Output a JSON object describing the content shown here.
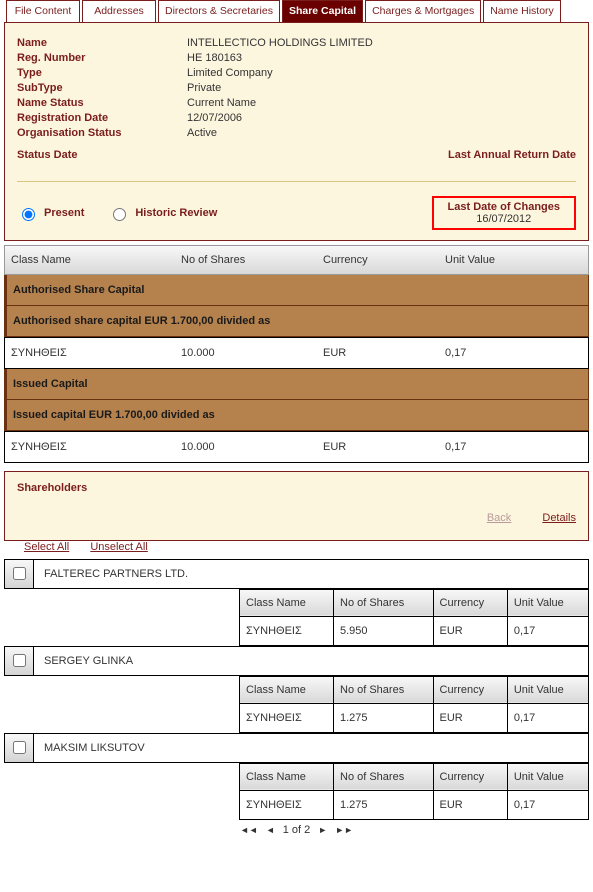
{
  "tabs": {
    "t0": "File Content",
    "t1": "Addresses",
    "t2": "Directors & Secretaries",
    "t3": "Share Capital",
    "t4": "Charges & Mortgages",
    "t5": "Name History"
  },
  "info": {
    "name_label": "Name",
    "name_value": "INTELLECTICO HOLDINGS LIMITED",
    "reg_label": "Reg. Number",
    "reg_value": "HE 180163",
    "type_label": "Type",
    "type_value": "Limited Company",
    "subtype_label": "SubType",
    "subtype_value": "Private",
    "namestatus_label": "Name Status",
    "namestatus_value": "Current Name",
    "regdate_label": "Registration Date",
    "regdate_value": "12/07/2006",
    "orgstatus_label": "Organisation Status",
    "orgstatus_value": "Active",
    "status_date_label": "Status Date",
    "last_return_label": "Last Annual Return Date"
  },
  "radio": {
    "present": "Present",
    "historic": "Historic Review"
  },
  "changes": {
    "title": "Last Date of Changes",
    "date": "16/07/2012"
  },
  "headers": {
    "class": "Class Name",
    "shares": "No of Shares",
    "curr": "Currency",
    "unit": "Unit Value"
  },
  "sections": {
    "auth_cap": "Authorised Share Capital",
    "auth_sub": "Authorised share capital EUR 1.700,00 divided as",
    "issued_cap": "Issued Capital",
    "issued_sub": "Issued capital EUR 1.700,00 divided as"
  },
  "main_rows": {
    "auth": {
      "class": "ΣΥΝΗΘΕΙΣ",
      "shares": "10.000",
      "curr": "EUR",
      "unit": "0,17"
    },
    "issued": {
      "class": "ΣΥΝΗΘΕΙΣ",
      "shares": "10.000",
      "curr": "EUR",
      "unit": "0,17"
    }
  },
  "sh": {
    "heading": "Shareholders",
    "back": "Back",
    "details": "Details",
    "select_all": "Select All",
    "unselect_all": "Unselect All"
  },
  "holders_list": [
    {
      "name": "FALTEREC PARTNERS LTD.",
      "class": "ΣΥΝΗΘΕΙΣ",
      "shares": "5.950",
      "curr": "EUR",
      "unit": "0,17"
    },
    {
      "name": "SERGEY GLINKA",
      "class": "ΣΥΝΗΘΕΙΣ",
      "shares": "1.275",
      "curr": "EUR",
      "unit": "0,17"
    },
    {
      "name": "MAKSIM LIKSUTOV",
      "class": "ΣΥΝΗΘΕΙΣ",
      "shares": "1.275",
      "curr": "EUR",
      "unit": "0,17"
    }
  ],
  "holders": {
    "h0": {
      "name": "FALTEREC PARTNERS LTD.",
      "class": "ΣΥΝΗΘΕΙΣ",
      "shares": "5.950",
      "curr": "EUR",
      "unit": "0,17"
    },
    "h1": {
      "name": "SERGEY GLINKA",
      "class": "ΣΥΝΗΘΕΙΣ",
      "shares": "1.275",
      "curr": "EUR",
      "unit": "0,17"
    },
    "h2": {
      "name": "MAKSIM LIKSUTOV",
      "class": "ΣΥΝΗΘΕΙΣ",
      "shares": "1.275",
      "curr": "EUR",
      "unit": "0,17"
    }
  },
  "pager": {
    "text": "1 of 2"
  }
}
